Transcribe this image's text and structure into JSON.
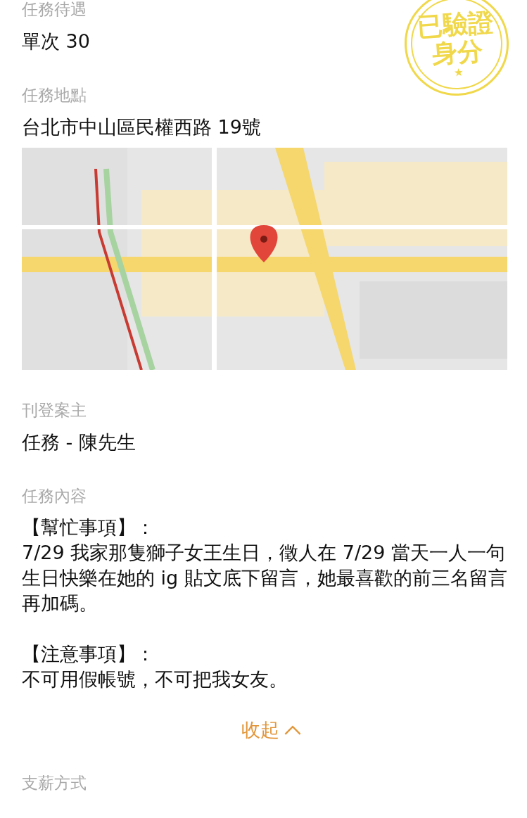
{
  "stamp": {
    "lines": [
      "已驗證",
      "身分"
    ]
  },
  "sections": [
    {
      "kind": "text",
      "label": "任務待遇",
      "value": "單次 30"
    },
    {
      "kind": "location",
      "label": "任務地點",
      "value": "台北市中山區民權西路 19號"
    },
    {
      "kind": "text",
      "label": "刊登案主",
      "value": "任務 - 陳先生"
    },
    {
      "kind": "blocks",
      "label": "任務內容",
      "blocks": [
        {
          "heading": "【幫忙事項】：",
          "body": "7/29 我家那隻獅子女王生日，徵人在 7/29 當天一人一句生日快樂在她的 ig 貼文底下留言，她最喜歡的前三名留言再加碼。"
        },
        {
          "heading": "【注意事項】：",
          "body": "不可用假帳號，不可把我女友。"
        }
      ],
      "collapse": {
        "label": "收起",
        "expanded": true
      }
    },
    {
      "kind": "label-only",
      "label": "支薪方式"
    }
  ]
}
